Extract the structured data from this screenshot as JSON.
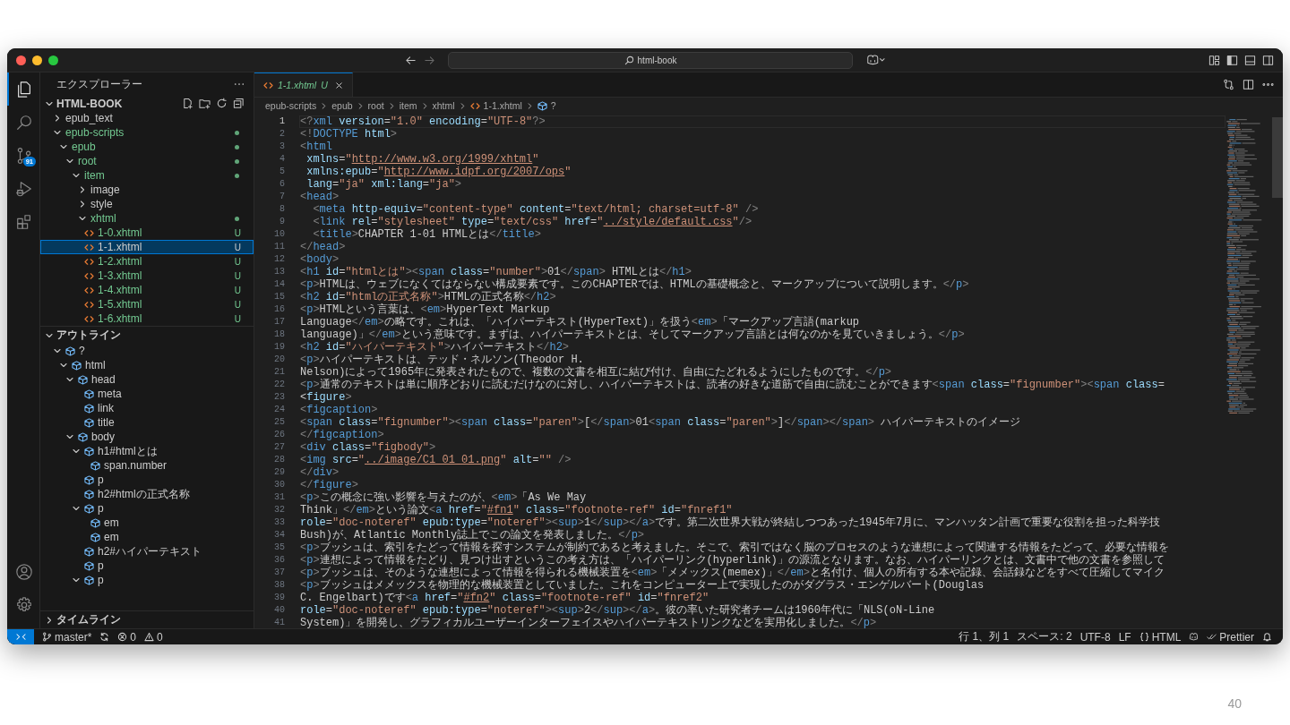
{
  "window": {
    "title": "html-book"
  },
  "activity_bar": {
    "items": [
      {
        "kind": "explorer",
        "selected": true
      },
      {
        "kind": "search",
        "selected": false
      },
      {
        "kind": "source_control",
        "selected": false,
        "badge": "91"
      },
      {
        "kind": "run_debug",
        "selected": false
      },
      {
        "kind": "extensions",
        "selected": false
      }
    ],
    "bottom": [
      {
        "kind": "account"
      },
      {
        "kind": "settings"
      }
    ]
  },
  "sidebar": {
    "title": "エクスプローラー",
    "explorer": {
      "label": "HTML-BOOK",
      "expanded": true,
      "tree": [
        {
          "kind": "folder",
          "label": "epub_text",
          "expanded": false,
          "untracked": false,
          "dot": false,
          "selected": false
        },
        {
          "kind": "folder",
          "label": "epub-scripts",
          "expanded": true,
          "untracked": true,
          "dot": true,
          "selected": false,
          "children": [
            {
              "kind": "folder",
              "label": "epub",
              "expanded": true,
              "untracked": true,
              "dot": true,
              "selected": false,
              "children": [
                {
                  "kind": "folder",
                  "label": "root",
                  "expanded": true,
                  "untracked": true,
                  "dot": true,
                  "selected": false,
                  "children": [
                    {
                      "kind": "folder",
                      "label": "item",
                      "expanded": true,
                      "untracked": true,
                      "dot": true,
                      "selected": false,
                      "children": [
                        {
                          "kind": "folder",
                          "label": "image",
                          "expanded": false,
                          "untracked": false,
                          "dot": false,
                          "selected": false
                        },
                        {
                          "kind": "folder",
                          "label": "style",
                          "expanded": false,
                          "untracked": false,
                          "dot": false,
                          "selected": false
                        },
                        {
                          "kind": "folder",
                          "label": "xhtml",
                          "expanded": true,
                          "untracked": true,
                          "dot": true,
                          "selected": false,
                          "children": [
                            {
                              "kind": "file",
                              "label": "1-0.xhtml",
                              "status": "U",
                              "untracked": true,
                              "selected": false
                            },
                            {
                              "kind": "file",
                              "label": "1-1.xhtml",
                              "status": "U",
                              "untracked": true,
                              "selected": true
                            },
                            {
                              "kind": "file",
                              "label": "1-2.xhtml",
                              "status": "U",
                              "untracked": true,
                              "selected": false
                            },
                            {
                              "kind": "file",
                              "label": "1-3.xhtml",
                              "status": "U",
                              "untracked": true,
                              "selected": false
                            },
                            {
                              "kind": "file",
                              "label": "1-4.xhtml",
                              "status": "U",
                              "untracked": true,
                              "selected": false
                            },
                            {
                              "kind": "file",
                              "label": "1-5.xhtml",
                              "status": "U",
                              "untracked": true,
                              "selected": false
                            },
                            {
                              "kind": "file",
                              "label": "1-6.xhtml",
                              "status": "U",
                              "untracked": true,
                              "selected": false
                            }
                          ]
                        }
                      ]
                    }
                  ]
                }
              ]
            }
          ]
        }
      ]
    },
    "outline": {
      "label": "アウトライン",
      "expanded": true,
      "tree": [
        {
          "label": "?",
          "expanded": true,
          "children": [
            {
              "label": "html",
              "expanded": true,
              "children": [
                {
                  "label": "head",
                  "expanded": true,
                  "children": [
                    {
                      "label": "meta"
                    },
                    {
                      "label": "link"
                    },
                    {
                      "label": "title"
                    }
                  ]
                },
                {
                  "label": "body",
                  "expanded": true,
                  "children": [
                    {
                      "label": "h1#htmlとは",
                      "expanded": true,
                      "children": [
                        {
                          "label": "span.number"
                        }
                      ]
                    },
                    {
                      "label": "p"
                    },
                    {
                      "label": "h2#htmlの正式名称"
                    },
                    {
                      "label": "p",
                      "expanded": true,
                      "children": [
                        {
                          "label": "em"
                        },
                        {
                          "label": "em"
                        }
                      ]
                    },
                    {
                      "label": "h2#ハイパーテキスト"
                    },
                    {
                      "label": "p"
                    },
                    {
                      "label": "p",
                      "expanded": true
                    }
                  ]
                }
              ]
            }
          ]
        }
      ]
    },
    "timeline": {
      "label": "タイムライン",
      "expanded": false
    }
  },
  "tabs": [
    {
      "label": "1-1.xhtml",
      "status": "U",
      "selected": true
    }
  ],
  "breadcrumb": [
    {
      "kind": "folder",
      "label": "epub-scripts"
    },
    {
      "kind": "folder",
      "label": "epub"
    },
    {
      "kind": "folder",
      "label": "root"
    },
    {
      "kind": "folder",
      "label": "item"
    },
    {
      "kind": "folder",
      "label": "xhtml"
    },
    {
      "kind": "file",
      "label": "1-1.xhtml"
    },
    {
      "kind": "symbol",
      "label": "?"
    }
  ],
  "editor": {
    "lines": [
      {
        "n": "1",
        "code": "<?xml version=\"1.0\" encoding=\"UTF-8\"?>",
        "current": true
      },
      {
        "n": "2",
        "code": "<!DOCTYPE html>",
        "current": false
      },
      {
        "n": "3",
        "code": "<html",
        "current": false
      },
      {
        "n": "4",
        "code": " xmlns=\"http://www.w3.org/1999/xhtml\"",
        "current": false
      },
      {
        "n": "5",
        "code": " xmlns:epub=\"http://www.idpf.org/2007/ops\"",
        "current": false
      },
      {
        "n": "6",
        "code": " lang=\"ja\" xml:lang=\"ja\">",
        "current": false
      },
      {
        "n": "7",
        "code": "<head>",
        "current": false
      },
      {
        "n": "8",
        "code": "  <meta http-equiv=\"content-type\" content=\"text/html; charset=utf-8\" />",
        "current": false
      },
      {
        "n": "9",
        "code": "  <link rel=\"stylesheet\" type=\"text/css\" href=\"../style/default.css\"/>",
        "current": false
      },
      {
        "n": "10",
        "code": "  <title>CHAPTER 1-01 HTMLとは</title>",
        "current": false
      },
      {
        "n": "11",
        "code": "</head>",
        "current": false
      },
      {
        "n": "12",
        "code": "<body>",
        "current": false
      },
      {
        "n": "13",
        "code": "<h1 id=\"htmlとは\"><span class=\"number\">01</span> HTMLとは</h1>",
        "current": false
      },
      {
        "n": "14",
        "code": "<p>HTMLは、ウェブになくてはならない構成要素です。このCHAPTERでは、HTMLの基礎概念と、マークアップについて説明します。</p>",
        "current": false
      },
      {
        "n": "15",
        "code": "<h2 id=\"htmlの正式名称\">HTMLの正式名称</h2>",
        "current": false
      },
      {
        "n": "16",
        "code": "<p>HTMLという言葉は、<em>HyperText Markup",
        "current": false
      },
      {
        "n": "17",
        "code": "Language</em>の略です。これは、「ハイパーテキスト(HyperText)」を扱う<em>「マークアップ言語(markup",
        "current": false
      },
      {
        "n": "18",
        "code": "language)」</em>という意味です。まずは、ハイパーテキストとは、そしてマークアップ言語とは何なのかを見ていきましょう。</p>",
        "current": false
      },
      {
        "n": "19",
        "code": "<h2 id=\"ハイパーテキスト\">ハイパーテキスト</h2>",
        "current": false
      },
      {
        "n": "20",
        "code": "<p>ハイパーテキストは、テッド・ネルソン(Theodor H.",
        "current": false
      },
      {
        "n": "21",
        "code": "Nelson)によって1965年に発表されたもので、複数の文書を相互に結び付け、自由にたどれるようにしたものです。</p>",
        "current": false
      },
      {
        "n": "22",
        "code": "<p>通常のテキストは単に順序どおりに読むだけなのに対し、ハイパーテキストは、読者の好きな道筋で自由に読むことができます<span class=\"fignumber\"><span class=",
        "current": false
      },
      {
        "n": "23",
        "code": "<figure>",
        "current": false
      },
      {
        "n": "24",
        "code": "<figcaption>",
        "current": false
      },
      {
        "n": "25",
        "code": "<span class=\"fignumber\"><span class=\"paren\">[</span>01<span class=\"paren\">]</span></span> ハイパーテキストのイメージ",
        "current": false
      },
      {
        "n": "26",
        "code": "</figcaption>",
        "current": false
      },
      {
        "n": "27",
        "code": "<div class=\"figbody\">",
        "current": false
      },
      {
        "n": "28",
        "code": "<img src=\"../image/C1_01_01.png\" alt=\"\" />",
        "current": false
      },
      {
        "n": "29",
        "code": "</div>",
        "current": false
      },
      {
        "n": "30",
        "code": "</figure>",
        "current": false
      },
      {
        "n": "31",
        "code": "<p>この概念に強い影響を与えたのが、<em>「As We May",
        "current": false
      },
      {
        "n": "32",
        "code": "Think」</em>という論文<a href=\"#fn1\" class=\"footnote-ref\" id=\"fnref1\"",
        "current": false
      },
      {
        "n": "33",
        "code": "role=\"doc-noteref\" epub:type=\"noteref\"><sup>1</sup></a>です。第二次世界大戦が終結しつつあった1945年7月に、マンハッタン計画で重要な役割を担った科学技",
        "current": false
      },
      {
        "n": "34",
        "code": "Bush)が、Atlantic Monthly誌上でこの論文を発表しました。</p>",
        "current": false
      },
      {
        "n": "35",
        "code": "<p>ブッシュは、索引をたどって情報を探すシステムが制約であると考えました。そこで、索引ではなく脳のプロセスのような連想によって関連する情報をたどって、必要な情報を",
        "current": false
      },
      {
        "n": "36",
        "code": "<p>連想によって情報をたどり、見つけ出すというこの考え方は、「ハイパーリンク(hyperlink)」の源流となります。なお、ハイパーリンクとは、文書中で他の文書を参照して",
        "current": false
      },
      {
        "n": "37",
        "code": "<p>ブッシュは、そのような連想によって情報を得られる機械装置を<em>「メメックス(memex)」</em>と名付け、個人の所有する本や記録、会話録などをすべて圧縮してマイク",
        "current": false
      },
      {
        "n": "38",
        "code": "<p>ブッシュはメメックスを物理的な機械装置としていました。これをコンピューター上で実現したのがダグラス・エンゲルバート(Douglas",
        "current": false
      },
      {
        "n": "39",
        "code": "C. Engelbart)です<a href=\"#fn2\" class=\"footnote-ref\" id=\"fnref2\"",
        "current": false
      },
      {
        "n": "40",
        "code": "role=\"doc-noteref\" epub:type=\"noteref\"><sup>2</sup></a>。彼の率いた研究者チームは1960年代に「NLS(oN-Line",
        "current": false
      },
      {
        "n": "41",
        "code": "System)」を開発し、グラフィカルユーザーインターフェイスやハイパーテキストリンクなどを実用化しました。</p>",
        "current": false
      }
    ]
  },
  "status_bar": {
    "left": [
      {
        "kind": "branch",
        "text": "master*"
      },
      {
        "kind": "sync"
      },
      {
        "kind": "errors",
        "text": "0"
      },
      {
        "kind": "warnings",
        "text": "0"
      }
    ],
    "right": [
      {
        "kind": "text",
        "text": "行 1、列 1"
      },
      {
        "kind": "text",
        "text": "スペース: 2"
      },
      {
        "kind": "text",
        "text": "UTF-8"
      },
      {
        "kind": "text",
        "text": "LF"
      },
      {
        "kind": "language",
        "text": "HTML"
      },
      {
        "kind": "copilot"
      },
      {
        "kind": "prettier",
        "text": "Prettier"
      },
      {
        "kind": "bell"
      }
    ]
  },
  "page_number": "40"
}
